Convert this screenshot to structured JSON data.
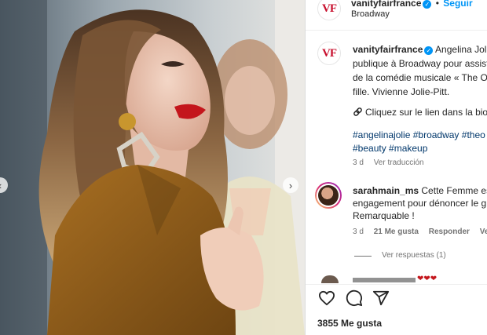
{
  "header": {
    "username": "vanityfairfrance",
    "follow_label": "Seguir",
    "location": "Broadway",
    "logo_text": "VF"
  },
  "caption": {
    "username": "vanityfairfrance",
    "lines": [
      "Angelina Jolie",
      "publique à Broadway pour assist",
      "de la comédie musicale « The Ou",
      "fille. Vivienne Jolie-Pitt."
    ],
    "link_line": "Cliquez sur le lien dans la bio",
    "hashtags_line1": "#angelinajolie #broadway #theo",
    "hashtags_line2": "#beauty #makeup",
    "time": "3 d",
    "translate_label": "Ver traducción"
  },
  "comment": {
    "username": "sarahmain_ms",
    "lines": [
      "Cette Femme est",
      "engagement pour dénoncer le g",
      "Remarquable !"
    ],
    "time": "3 d",
    "likes": "21 Me gusta",
    "reply_label": "Responder",
    "translate_label": "Ver t",
    "view_replies": "Ver respuestas (1)"
  },
  "footer": {
    "likes_count": "3855 Me gusta"
  },
  "colors": {
    "accent": "#0095f6",
    "brand_red": "#c8102e",
    "link": "#00376b",
    "muted": "#737373"
  },
  "icons": [
    "verified-badge-icon",
    "heart-icon",
    "comment-icon",
    "share-icon",
    "link-icon",
    "chevron-left-icon",
    "chevron-right-icon"
  ]
}
